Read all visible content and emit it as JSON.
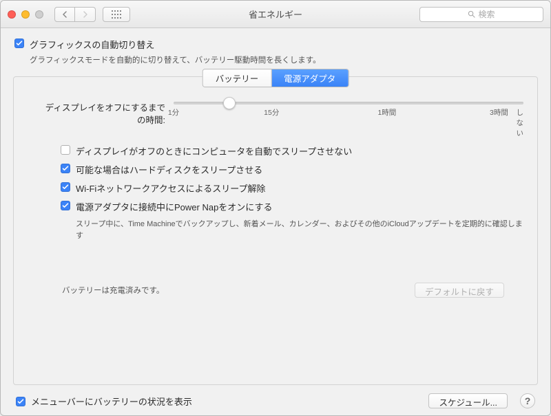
{
  "window": {
    "title": "省エネルギー"
  },
  "toolbar": {
    "search_placeholder": "検索"
  },
  "top_option": {
    "label": "グラフィックスの自動切り替え",
    "description": "グラフィックスモードを自動的に切り替えて、バッテリー駆動時間を長くします。",
    "checked": true
  },
  "tabs": {
    "battery": "バッテリー",
    "adapter": "電源アダプタ",
    "active": "adapter"
  },
  "slider": {
    "label_line1": "ディスプレイをオフにするまで",
    "label_line2": "の時間:",
    "value_percent": 16,
    "ticks": [
      {
        "pos": 0,
        "label": "1分"
      },
      {
        "pos": 28,
        "label": "15分"
      },
      {
        "pos": 61,
        "label": "1時間"
      },
      {
        "pos": 93,
        "label": "3時間"
      },
      {
        "pos": 100,
        "label": "しない"
      }
    ]
  },
  "options": [
    {
      "checked": false,
      "label": "ディスプレイがオフのときにコンピュータを自動でスリープさせない"
    },
    {
      "checked": true,
      "label": "可能な場合はハードディスクをスリープさせる"
    },
    {
      "checked": true,
      "label": "Wi-Fiネットワークアクセスによるスリープ解除"
    },
    {
      "checked": true,
      "label": "電源アダプタに接続中にPower Napをオンにする",
      "sub": "スリープ中に、Time Machineでバックアップし、新着メール、カレンダー、およびその他のiCloudアップデートを定期的に確認します"
    }
  ],
  "status": "バッテリーは充電済みです。",
  "buttons": {
    "restore_defaults": "デフォルトに戻す",
    "schedule": "スケジュール..."
  },
  "bottom_option": {
    "label": "メニューバーにバッテリーの状況を表示",
    "checked": true
  }
}
